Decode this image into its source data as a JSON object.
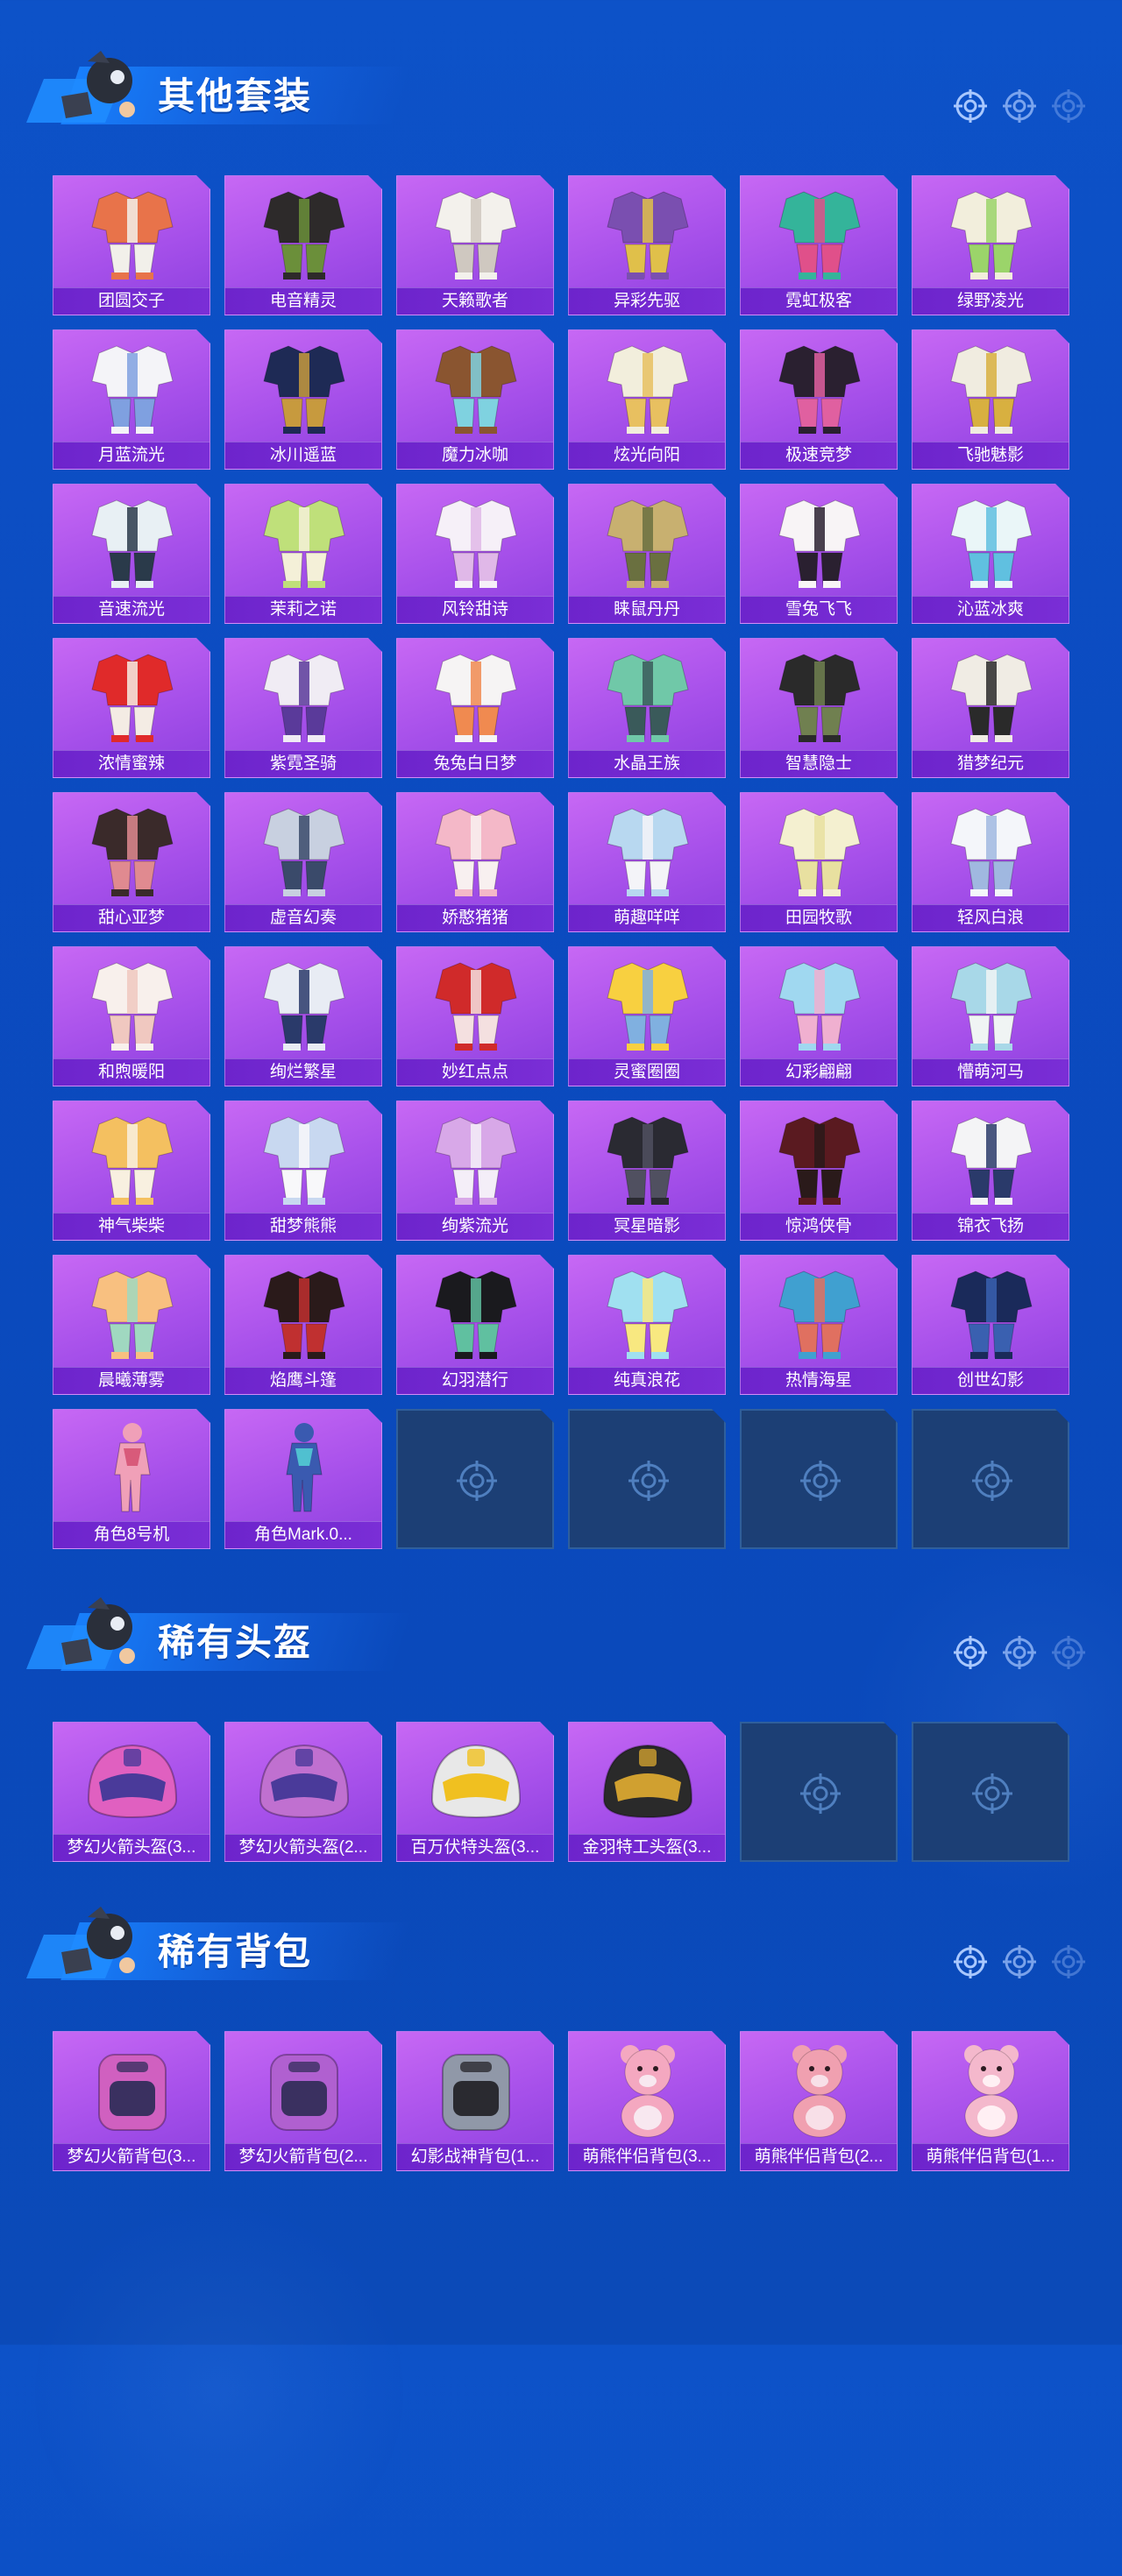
{
  "sections": [
    {
      "title": "其他套装",
      "items": [
        {
          "label": "团圆交子",
          "kind": "outfit",
          "c1": "#e8734a",
          "c2": "#f2f0ea"
        },
        {
          "label": "电音精灵",
          "kind": "outfit",
          "c1": "#2d2a2a",
          "c2": "#6b8f3a"
        },
        {
          "label": "天籁歌者",
          "kind": "outfit",
          "c1": "#f3f1ec",
          "c2": "#cfc8c0"
        },
        {
          "label": "异彩先驱",
          "kind": "outfit",
          "c1": "#7a4fb0",
          "c2": "#e0c04a"
        },
        {
          "label": "霓虹极客",
          "kind": "outfit",
          "c1": "#34b49a",
          "c2": "#e0508a"
        },
        {
          "label": "绿野凌光",
          "kind": "outfit",
          "c1": "#f2eedc",
          "c2": "#9bd46a"
        },
        {
          "label": "月蓝流光",
          "kind": "outfit",
          "c1": "#f4f4f8",
          "c2": "#7fa0e0"
        },
        {
          "label": "冰川遥蓝",
          "kind": "outfit",
          "c1": "#1e2a55",
          "c2": "#c79a3e"
        },
        {
          "label": "魔力冰咖",
          "kind": "outfit",
          "c1": "#8a5530",
          "c2": "#7fd2e0"
        },
        {
          "label": "炫光向阳",
          "kind": "outfit",
          "c1": "#f2eedc",
          "c2": "#e8c060"
        },
        {
          "label": "极速竞梦",
          "kind": "outfit",
          "c1": "#2a2030",
          "c2": "#e060a0"
        },
        {
          "label": "飞驰魅影",
          "kind": "outfit",
          "c1": "#f0ece0",
          "c2": "#d8b040"
        },
        {
          "label": "音速流光",
          "kind": "outfit",
          "c1": "#e8f0f4",
          "c2": "#2a3a4a"
        },
        {
          "label": "茉莉之诺",
          "kind": "outfit",
          "c1": "#bfe07a",
          "c2": "#f4f0d8"
        },
        {
          "label": "风铃甜诗",
          "kind": "outfit",
          "c1": "#f6f0f8",
          "c2": "#e0b8e8"
        },
        {
          "label": "睐鼠丹丹",
          "kind": "outfit",
          "c1": "#c8b070",
          "c2": "#6a7040"
        },
        {
          "label": "雪兔飞飞",
          "kind": "outfit",
          "c1": "#f8f4f6",
          "c2": "#2a2030"
        },
        {
          "label": "沁蓝冰爽",
          "kind": "outfit",
          "c1": "#eaf6f8",
          "c2": "#60c0e0"
        },
        {
          "label": "浓情蜜辣",
          "kind": "outfit",
          "c1": "#e02a2a",
          "c2": "#f4ece4"
        },
        {
          "label": "紫霓圣骑",
          "kind": "outfit",
          "c1": "#f0ecf4",
          "c2": "#5a3a9a"
        },
        {
          "label": "兔兔白日梦",
          "kind": "outfit",
          "c1": "#f6f4f4",
          "c2": "#f08a50"
        },
        {
          "label": "水晶王族",
          "kind": "outfit",
          "c1": "#70c8a8",
          "c2": "#3a5a5a"
        },
        {
          "label": "智慧隐士",
          "kind": "outfit",
          "c1": "#2a2a2a",
          "c2": "#708050"
        },
        {
          "label": "猎梦纪元",
          "kind": "outfit",
          "c1": "#f0ece4",
          "c2": "#2a2a2a"
        },
        {
          "label": "甜心亚梦",
          "kind": "outfit",
          "c1": "#3a2a2a",
          "c2": "#e08a90"
        },
        {
          "label": "虚音幻奏",
          "kind": "outfit",
          "c1": "#c8d0e0",
          "c2": "#3a4a6a"
        },
        {
          "label": "娇憨猪猪",
          "kind": "outfit",
          "c1": "#f4b8c8",
          "c2": "#f8f0f0"
        },
        {
          "label": "萌趣咩咩",
          "kind": "outfit",
          "c1": "#b8d8f0",
          "c2": "#f4f4f8"
        },
        {
          "label": "田园牧歌",
          "kind": "outfit",
          "c1": "#f4f0d0",
          "c2": "#e8e0a0"
        },
        {
          "label": "轻风白浪",
          "kind": "outfit",
          "c1": "#f4f6fa",
          "c2": "#a0b8e0"
        },
        {
          "label": "和煦暖阳",
          "kind": "outfit",
          "c1": "#f8f0ec",
          "c2": "#f0c8c0"
        },
        {
          "label": "绚烂繁星",
          "kind": "outfit",
          "c1": "#e8ecf4",
          "c2": "#2a3a6a"
        },
        {
          "label": "妙红点点",
          "kind": "outfit",
          "c1": "#d02a2a",
          "c2": "#f4e0e0"
        },
        {
          "label": "灵蜜圈圈",
          "kind": "outfit",
          "c1": "#f8d040",
          "c2": "#80b0e0"
        },
        {
          "label": "幻彩翩翩",
          "kind": "outfit",
          "c1": "#a0d8f0",
          "c2": "#f0b0d0"
        },
        {
          "label": "懵萌河马",
          "kind": "outfit",
          "c1": "#a8d8e8",
          "c2": "#f0f4f4"
        },
        {
          "label": "神气柴柴",
          "kind": "outfit",
          "c1": "#f4c060",
          "c2": "#f8f0e0"
        },
        {
          "label": "甜梦熊熊",
          "kind": "outfit",
          "c1": "#c8d8f0",
          "c2": "#f8f8fa"
        },
        {
          "label": "绚紫流光",
          "kind": "outfit",
          "c1": "#d8a8e8",
          "c2": "#f4eef8"
        },
        {
          "label": "冥星暗影",
          "kind": "outfit",
          "c1": "#2a2a32",
          "c2": "#505060"
        },
        {
          "label": "惊鸿侠骨",
          "kind": "outfit",
          "c1": "#5a1a20",
          "c2": "#2a1a1a"
        },
        {
          "label": "锦衣飞扬",
          "kind": "outfit",
          "c1": "#f4f4f6",
          "c2": "#2a3a6a"
        },
        {
          "label": "晨曦薄雾",
          "kind": "outfit",
          "c1": "#f8c080",
          "c2": "#a0d8c0"
        },
        {
          "label": "焰鹰斗篷",
          "kind": "outfit",
          "c1": "#2a1a1a",
          "c2": "#c03030"
        },
        {
          "label": "幻羽潜行",
          "kind": "outfit",
          "c1": "#1a1a1e",
          "c2": "#60c0a0"
        },
        {
          "label": "纯真浪花",
          "kind": "outfit",
          "c1": "#a0e0f0",
          "c2": "#f8e880"
        },
        {
          "label": "热情海星",
          "kind": "outfit",
          "c1": "#40a0d0",
          "c2": "#e07060"
        },
        {
          "label": "创世幻影",
          "kind": "outfit",
          "c1": "#1a2a5a",
          "c2": "#3a60b0"
        },
        {
          "label": "角色8号机",
          "kind": "suit",
          "c1": "#f0a0b8",
          "c2": "#d85a7a"
        },
        {
          "label": "角色Mark.0...",
          "kind": "suit",
          "c1": "#3a5ab0",
          "c2": "#50c0d0"
        },
        {
          "label": "",
          "kind": "empty"
        },
        {
          "label": "",
          "kind": "empty"
        },
        {
          "label": "",
          "kind": "empty"
        },
        {
          "label": "",
          "kind": "empty"
        }
      ]
    },
    {
      "title": "稀有头盔",
      "items": [
        {
          "label": "梦幻火箭头盔(3...",
          "kind": "helmet",
          "c1": "#e060c0",
          "c2": "#4a3a9a"
        },
        {
          "label": "梦幻火箭头盔(2...",
          "kind": "helmet",
          "c1": "#c070d0",
          "c2": "#4a3a9a"
        },
        {
          "label": "百万伏特头盔(3...",
          "kind": "helmet",
          "c1": "#e8e8e8",
          "c2": "#f0c020"
        },
        {
          "label": "金羽特工头盔(3...",
          "kind": "helmet",
          "c1": "#2a2a2a",
          "c2": "#d0a030"
        },
        {
          "label": "",
          "kind": "empty"
        },
        {
          "label": "",
          "kind": "empty"
        }
      ]
    },
    {
      "title": "稀有背包",
      "items": [
        {
          "label": "梦幻火箭背包(3...",
          "kind": "backpack",
          "c1": "#d060c0",
          "c2": "#3a3060"
        },
        {
          "label": "梦幻火箭背包(2...",
          "kind": "backpack",
          "c1": "#b060d0",
          "c2": "#3a3060"
        },
        {
          "label": "幻影战神背包(1...",
          "kind": "backpack",
          "c1": "#9098a8",
          "c2": "#2a2a30"
        },
        {
          "label": "萌熊伴侣背包(3...",
          "kind": "bear",
          "c1": "#f4a8c0",
          "c2": "#f8e8f0"
        },
        {
          "label": "萌熊伴侣背包(2...",
          "kind": "bear",
          "c1": "#f0a0b0",
          "c2": "#f8e0e8"
        },
        {
          "label": "萌熊伴侣背包(1...",
          "kind": "bear",
          "c1": "#f4b8cc",
          "c2": "#fff0f4"
        }
      ]
    }
  ]
}
